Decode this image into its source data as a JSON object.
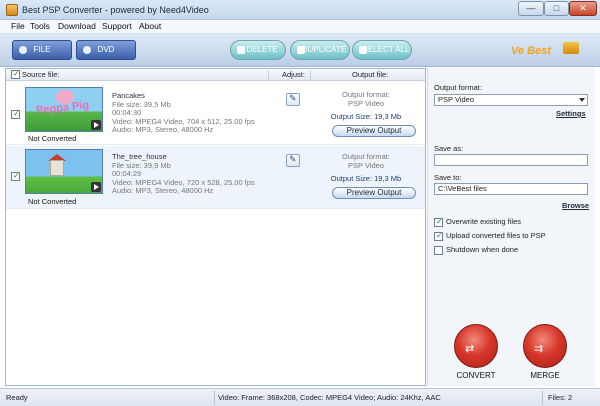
{
  "window": {
    "title": "Best PSP Converter - powered by Need4Video",
    "min_label": "—",
    "max_label": "□",
    "close_label": "✕"
  },
  "menu": [
    "File",
    "Tools",
    "Download",
    "Support",
    "About"
  ],
  "toolbar": {
    "file_label": "FILE",
    "dvd_label": "DVD",
    "delete_label": "DELETE",
    "duplicate_label": "DUPLICATE",
    "select_all_label": "SELECT ALL",
    "logo_text": "Ve Best"
  },
  "list": {
    "headers": {
      "source": "Source file:",
      "adjust": "Adjust:",
      "output": "Output file:"
    },
    "rows": [
      {
        "status": "Not Converted",
        "thumb_text": "Peppa Pig",
        "name": "Pancakes",
        "size": "File size: 39,5 Mb",
        "duration": "00:04:30",
        "video": "Video: MPEG4 Video, 704 x 512, 25.00 fps",
        "audio": "Audio: MP3, Stereo, 48000 Hz",
        "out_format_label": "Output format:",
        "out_format": "PSP Video",
        "out_size": "Output Size: 19,3 Mb",
        "preview": "Preview Output"
      },
      {
        "status": "Not Converted",
        "name": "The_tree_house",
        "size": "File size: 39,9 Mb",
        "duration": "00:04:29",
        "video": "Video: MPEG4 Video, 720 x 528, 25.00 fps",
        "audio": "Audio: MP3, Stereo, 48000 Hz",
        "out_format_label": "Output format:",
        "out_format": "PSP Video",
        "out_size": "Output Size: 19,3 Mb",
        "preview": "Preview Output"
      }
    ]
  },
  "panel": {
    "output_format_label": "Output format:",
    "output_format_value": "PSP Video",
    "settings_link": "Settings",
    "save_as_label": "Save as:",
    "save_as_value": "",
    "save_to_label": "Save to:",
    "save_to_value": "C:\\VeBest files",
    "browse_link": "Browse",
    "options": [
      {
        "label": "Overwrite existing files",
        "checked": true
      },
      {
        "label": "Upload converted files to PSP",
        "checked": true
      },
      {
        "label": "Shutdown when done",
        "checked": false
      }
    ],
    "convert_label": "CONVERT",
    "merge_label": "MERGE"
  },
  "statusbar": {
    "left": "Ready",
    "middle": "Video: Frame: 368x208, Codec: MPEG4 Video; Audio: 24Khz, AAC",
    "right": "Files: 2"
  }
}
